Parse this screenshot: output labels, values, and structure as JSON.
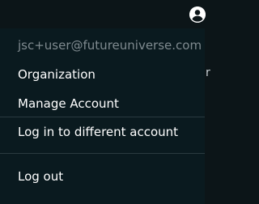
{
  "background": {
    "partial_text": "r"
  },
  "header": {
    "avatar_icon": "account-circle-icon"
  },
  "account_menu": {
    "email": "jsc+user@futureuniverse.com",
    "items": [
      {
        "label": "Organization"
      },
      {
        "label": "Manage Account"
      },
      {
        "label": "Log in to different account"
      },
      {
        "label": "Log out"
      }
    ]
  },
  "colors": {
    "page_background": "#0c1518",
    "menu_background": "#0a1a1f",
    "menu_text": "#ffffff",
    "muted_text": "#7f8a8f",
    "divider": "#2a3a40"
  }
}
